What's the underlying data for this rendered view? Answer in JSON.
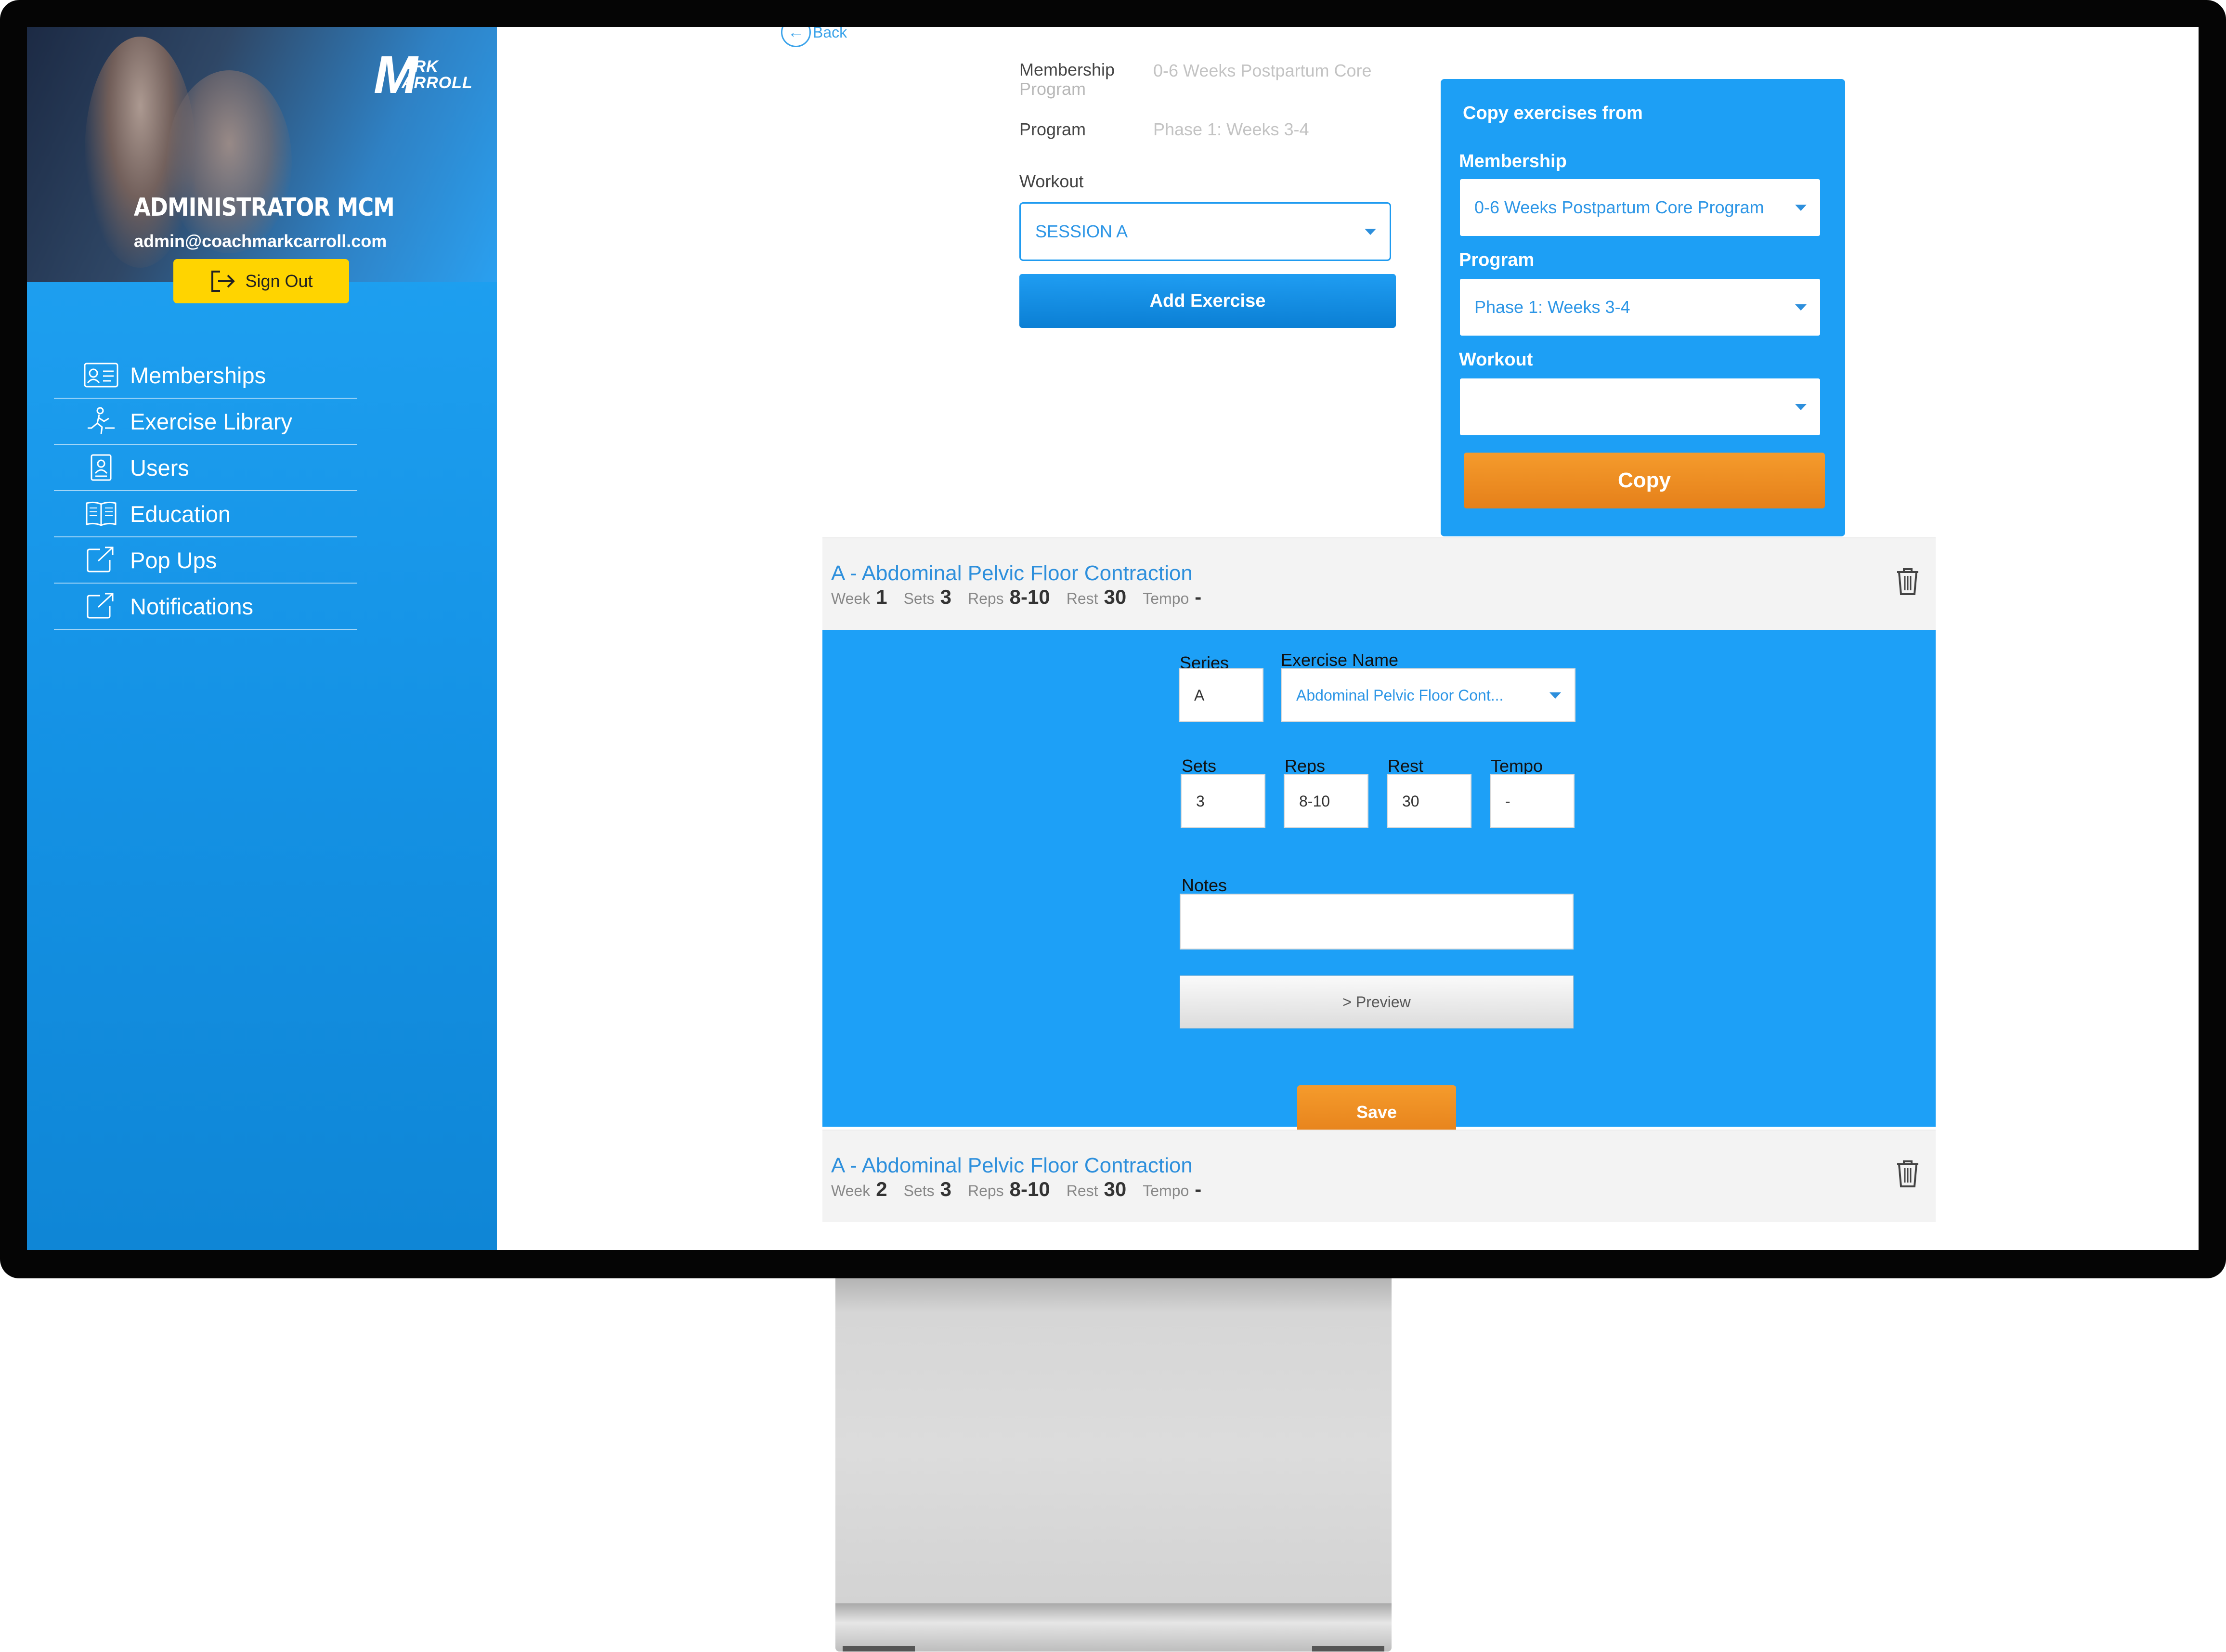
{
  "user": {
    "name": "ADMINISTRATOR MCM",
    "email": "admin@coachmarkcarroll.com",
    "sign_out": "Sign Out"
  },
  "logo": {
    "m": "M",
    "line1": "ARK",
    "line2": "ARROLL"
  },
  "nav": [
    {
      "label": "Memberships",
      "icon": "id-card-icon"
    },
    {
      "label": "Exercise Library",
      "icon": "running-figure-icon"
    },
    {
      "label": "Users",
      "icon": "user-badge-icon"
    },
    {
      "label": "Education",
      "icon": "book-icon"
    },
    {
      "label": "Pop Ups",
      "icon": "external-link-icon"
    },
    {
      "label": "Notifications",
      "icon": "external-link-icon"
    }
  ],
  "back_label": "Back",
  "info": {
    "membership_label": "Membership",
    "membership_sub": "Program",
    "membership_value": "0-6 Weeks Postpartum Core",
    "program_label": "Program",
    "program_value": "Phase 1: Weeks 3-4",
    "workout_label": "Workout",
    "workout_value": "SESSION A",
    "add_exercise": "Add Exercise"
  },
  "copy_panel": {
    "title": "Copy exercises from",
    "membership_label": "Membership",
    "membership_value": "0-6 Weeks Postpartum Core Program",
    "program_label": "Program",
    "program_value": "Phase 1: Weeks 3-4",
    "workout_label": "Workout",
    "workout_value": "",
    "copy_button": "Copy"
  },
  "exercises": [
    {
      "title": "A - Abdominal Pelvic Floor Contraction",
      "week_label": "Week",
      "week": "1",
      "sets_label": "Sets",
      "sets": "3",
      "reps_label": "Reps",
      "reps": "8-10",
      "rest_label": "Rest",
      "rest": "30",
      "tempo_label": "Tempo",
      "tempo": "-"
    },
    {
      "title": "A - Abdominal Pelvic Floor Contraction",
      "week_label": "Week",
      "week": "2",
      "sets_label": "Sets",
      "sets": "3",
      "reps_label": "Reps",
      "reps": "8-10",
      "rest_label": "Rest",
      "rest": "30",
      "tempo_label": "Tempo",
      "tempo": "-"
    }
  ],
  "editor": {
    "series_label": "Series",
    "series_value": "A",
    "exercise_name_label": "Exercise Name",
    "exercise_name_value": "Abdominal Pelvic Floor Cont...",
    "sets_label": "Sets",
    "sets_value": "3",
    "reps_label": "Reps",
    "reps_value": "8-10",
    "rest_label": "Rest",
    "rest_value": "30",
    "tempo_label": "Tempo",
    "tempo_value": "-",
    "notes_label": "Notes",
    "notes_value": "",
    "preview_label": "> Preview",
    "save_label": "Save"
  },
  "colors": {
    "sidebar": "#1593e6",
    "accent_blue": "#1da0f7",
    "link_blue": "#2d8fdc",
    "orange": "#f08c22",
    "signout_yellow": "#ffd400"
  }
}
